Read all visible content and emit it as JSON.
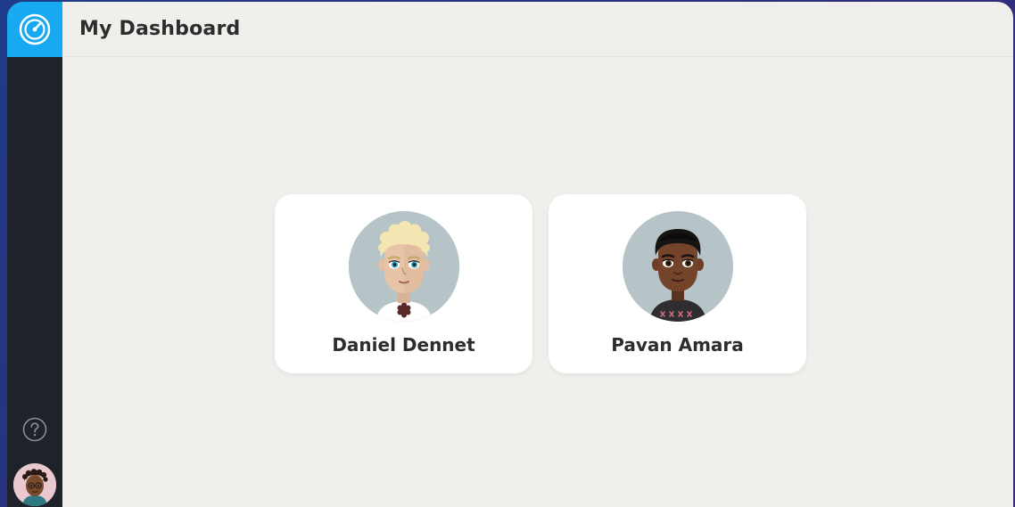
{
  "header": {
    "title": "My Dashboard"
  },
  "sidebar": {
    "logo_icon": "speedometer-icon",
    "help_icon": "help-circle-icon",
    "user_avatar": "user-avatar"
  },
  "students": [
    {
      "name": "Daniel Dennet",
      "avatar": "blond-boy-avatar"
    },
    {
      "name": "Pavan Amara",
      "avatar": "dark-haired-boy-avatar"
    }
  ],
  "colors": {
    "accent": "#17a9f2",
    "sidebar": "#1e222b",
    "background": "#f0efec",
    "card": "#ffffff",
    "avatar_bg": "#b6c3c7"
  }
}
